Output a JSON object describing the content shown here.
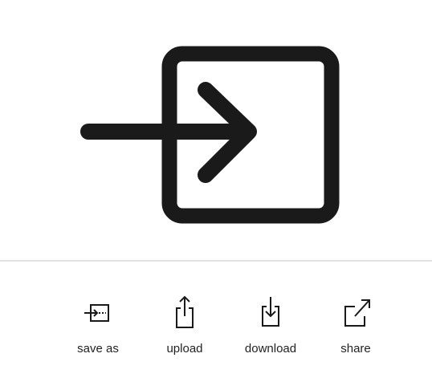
{
  "hero": {
    "icon": "enter-arrow-into-box-icon"
  },
  "actions": [
    {
      "label": "save as",
      "icon": "save-as-icon"
    },
    {
      "label": "upload",
      "icon": "upload-icon"
    },
    {
      "label": "download",
      "icon": "download-icon"
    },
    {
      "label": "share",
      "icon": "share-icon"
    }
  ],
  "colors": {
    "icon": "#1a1a1a",
    "divider": "#e2e2e2",
    "background": "#ffffff"
  }
}
